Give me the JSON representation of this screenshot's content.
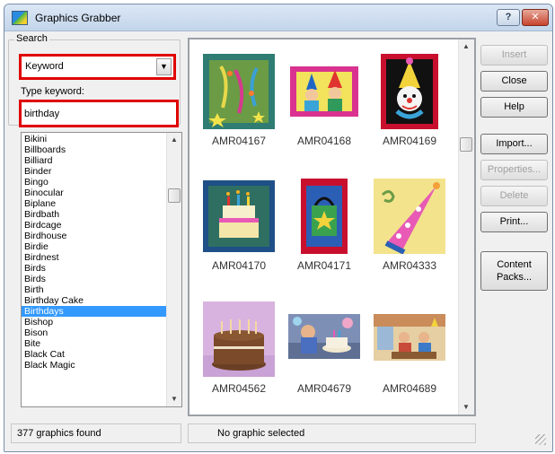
{
  "window": {
    "title": "Graphics Grabber",
    "help_glyph": "?",
    "close_glyph": "✕"
  },
  "search": {
    "group_label": "Search",
    "mode_value": "Keyword",
    "dropdown_glyph": "▼",
    "keyword_label": "Type keyword:",
    "keyword_value": "birthday"
  },
  "keywords": {
    "items": [
      "Bikini",
      "Billboards",
      "Billiard",
      "Binder",
      "Bingo",
      "Binocular",
      "Biplane",
      "Birdbath",
      "Birdcage",
      "Birdhouse",
      "Birdie",
      "Birdnest",
      "Birds",
      "Birds",
      "Birth",
      "Birthday Cake",
      "Birthdays",
      "Bishop",
      "Bison",
      "Bite",
      "Black Cat",
      "Black Magic"
    ],
    "selected_index": 16,
    "scroll_position": 0.18
  },
  "gallery": {
    "items": [
      {
        "code": "AMR04167",
        "art": "confetti"
      },
      {
        "code": "AMR04168",
        "art": "party-people"
      },
      {
        "code": "AMR04169",
        "art": "clown"
      },
      {
        "code": "AMR04170",
        "art": "cake"
      },
      {
        "code": "AMR04171",
        "art": "gift-bag"
      },
      {
        "code": "AMR04333",
        "art": "party-hat"
      },
      {
        "code": "AMR04562",
        "art": "cake-photo"
      },
      {
        "code": "AMR04679",
        "art": "kid-photo"
      },
      {
        "code": "AMR04689",
        "art": "party-photo"
      }
    ],
    "scroll_position": 0.25,
    "up_glyph": "▲",
    "down_glyph": "▼"
  },
  "buttons": {
    "insert": "Insert",
    "close": "Close",
    "help": "Help",
    "import": "Import...",
    "properties": "Properties...",
    "delete": "Delete",
    "print": "Print...",
    "content_packs_1": "Content",
    "content_packs_2": "Packs..."
  },
  "status": {
    "count_text": "377 graphics found",
    "selection_text": "No graphic selected"
  }
}
